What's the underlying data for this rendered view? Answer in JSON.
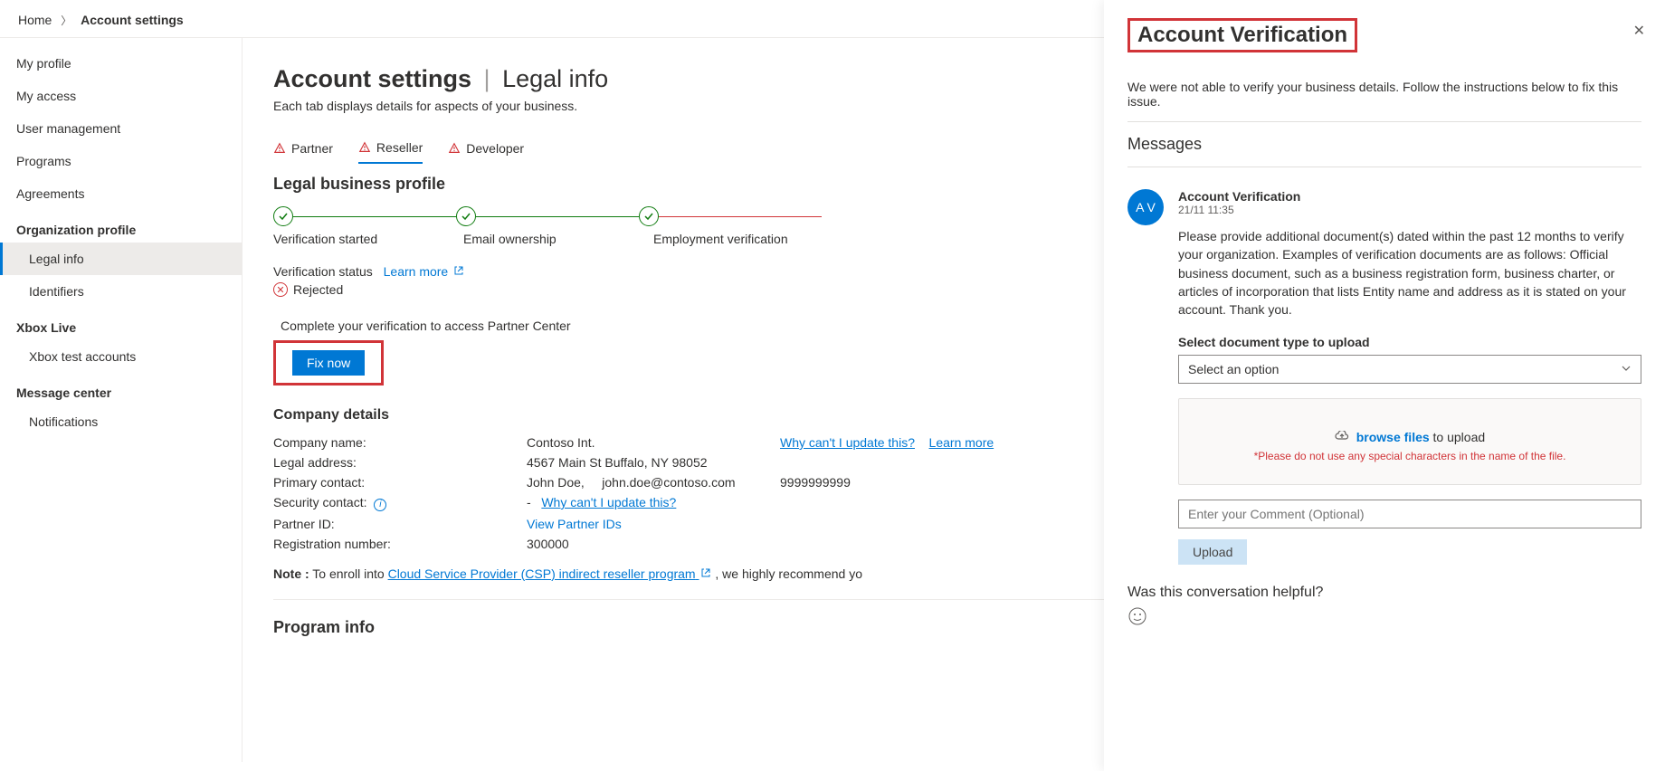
{
  "breadcrumb": {
    "home": "Home",
    "current": "Account settings"
  },
  "sidebar": {
    "items": [
      "My profile",
      "My access",
      "User management",
      "Programs",
      "Agreements"
    ],
    "org_section": "Organization profile",
    "org_items": [
      "Legal info",
      "Identifiers"
    ],
    "xbox_section": "Xbox Live",
    "xbox_items": [
      "Xbox test accounts"
    ],
    "msg_section": "Message center",
    "msg_items": [
      "Notifications"
    ]
  },
  "page": {
    "title_a": "Account settings",
    "title_b": "Legal info",
    "subtitle": "Each tab displays details for aspects of your business."
  },
  "tabs": [
    "Partner",
    "Reseller",
    "Developer"
  ],
  "section": {
    "legal_profile": "Legal business profile"
  },
  "steps": [
    "Verification started",
    "Email ownership",
    "Employment verification"
  ],
  "status": {
    "label": "Verification status",
    "learn": "Learn more",
    "rejected": "Rejected",
    "complete_msg": "Complete your verification to access Partner Center",
    "fix_now": "Fix now"
  },
  "company": {
    "heading": "Company details",
    "rows": {
      "name_label": "Company name:",
      "name_val": "Contoso Int.",
      "why": "Why can't I update this?",
      "learn": "Learn more",
      "addr_label": "Legal address:",
      "addr_val": "4567 Main St Buffalo, NY 98052",
      "primary_label": "Primary contact:",
      "primary_name": "John Doe,",
      "primary_email": "john.doe@contoso.com",
      "primary_phone": "9999999999",
      "security_label": "Security contact:",
      "security_dash": "-",
      "partner_label": "Partner ID:",
      "partner_link": "View Partner IDs",
      "reg_label": "Registration number:",
      "reg_val": "300000"
    },
    "note_label": "Note :",
    "note_text": " To enroll into ",
    "note_link": "Cloud Service Provider (CSP) indirect reseller program",
    "note_tail": " , we highly recommend yo"
  },
  "program_info": "Program info",
  "panel": {
    "title": "Account Verification",
    "intro": "We were not able to verify your business details. Follow the instructions below to fix this issue.",
    "messages_h": "Messages",
    "avatar": "A V",
    "from": "Account Verification",
    "ts": "21/11 11:35",
    "body": "Please provide additional document(s) dated within the past 12 months to verify your organization. Examples of verification documents are as follows: Official business document, such as a business registration form, business charter, or articles of incorporation that lists Entity name and address as it is stated on your account. Thank you.",
    "select_label": "Select document type to upload",
    "select_placeholder": "Select an option",
    "browse": "browse files",
    "upload_tail": " to upload",
    "file_warn": "*Please do not use any special characters in the name of the file.",
    "comment_ph": "Enter your Comment (Optional)",
    "upload_btn": "Upload",
    "helpful": "Was this conversation helpful?"
  }
}
